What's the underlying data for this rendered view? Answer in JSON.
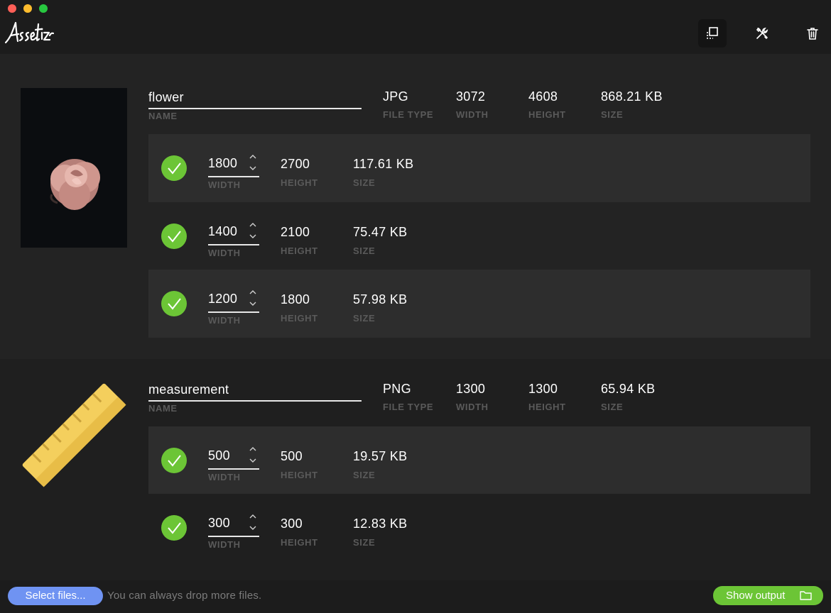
{
  "app": {
    "logo_text": "Assetizr"
  },
  "toolbar": {
    "icons": [
      "resize-icon",
      "tools-icon",
      "trash-icon"
    ]
  },
  "assets": [
    {
      "name": "flower",
      "name_label": "NAME",
      "file_type": "JPG",
      "file_type_label": "FILE TYPE",
      "width": "3072",
      "width_label": "WIDTH",
      "height": "4608",
      "height_label": "HEIGHT",
      "size": "868.21 KB",
      "size_label": "SIZE",
      "variants": [
        {
          "width": "1800",
          "width_label": "WIDTH",
          "height": "2700",
          "height_label": "HEIGHT",
          "size": "117.61 KB",
          "size_label": "SIZE"
        },
        {
          "width": "1400",
          "width_label": "WIDTH",
          "height": "2100",
          "height_label": "HEIGHT",
          "size": "75.47 KB",
          "size_label": "SIZE"
        },
        {
          "width": "1200",
          "width_label": "WIDTH",
          "height": "1800",
          "height_label": "HEIGHT",
          "size": "57.98 KB",
          "size_label": "SIZE"
        }
      ]
    },
    {
      "name": "measurement",
      "name_label": "NAME",
      "file_type": "PNG",
      "file_type_label": "FILE TYPE",
      "width": "1300",
      "width_label": "WIDTH",
      "height": "1300",
      "height_label": "HEIGHT",
      "size": "65.94 KB",
      "size_label": "SIZE",
      "variants": [
        {
          "width": "500",
          "width_label": "WIDTH",
          "height": "500",
          "height_label": "HEIGHT",
          "size": "19.57 KB",
          "size_label": "SIZE"
        },
        {
          "width": "300",
          "width_label": "WIDTH",
          "height": "300",
          "height_label": "HEIGHT",
          "size": "12.83 KB",
          "size_label": "SIZE"
        }
      ]
    }
  ],
  "footer": {
    "select_label": "Select files...",
    "hint": "You can always drop more files.",
    "output_label": "Show output"
  },
  "colors": {
    "accent_green": "#6cc536",
    "accent_blue": "#6f93f2",
    "background": "#1f1f1f"
  }
}
